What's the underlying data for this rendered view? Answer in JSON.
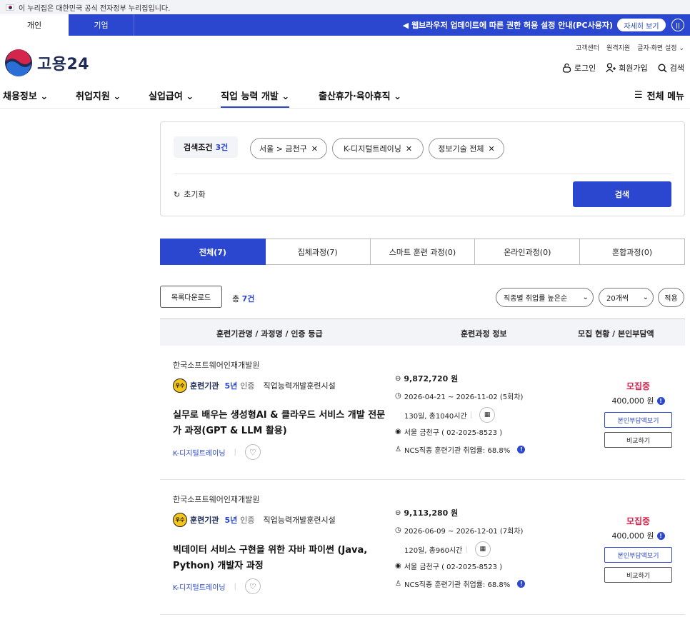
{
  "gov_banner": {
    "text": "이 누리집은 대한민국 공식 전자정부 누리집입니다."
  },
  "topbar": {
    "tabs": [
      "개인",
      "기업"
    ],
    "notice": "웹브라우저 업데이트에 따른 권한 허용 설정 안내(PC사용자)",
    "detail": "자세히 보기"
  },
  "header": {
    "logo": "고용24",
    "util": [
      "고객센터",
      "원격지원",
      "글자·화면 설정"
    ],
    "login": "로그인",
    "signup": "회원가입",
    "search": "검색"
  },
  "gnb": {
    "items": [
      "채용정보",
      "취업지원",
      "실업급여",
      "직업 능력 개발",
      "출산휴가·육아휴직"
    ],
    "allmenu": "전체 메뉴"
  },
  "search": {
    "cond_label": "검색조건",
    "cond_count": "3건",
    "chips": [
      "서울 > 금천구",
      "K-디지털트레이닝",
      "정보기술 전체"
    ],
    "reset": "초기화",
    "button": "검색"
  },
  "tabs": [
    "전체(7)",
    "집체과정(7)",
    "스마트 훈련 과정(0)",
    "온라인과정(0)",
    "혼합과정(0)"
  ],
  "controls": {
    "download": "목록다운로드",
    "total_prefix": "총",
    "total_count": "7건",
    "sort": "직종별 취업률 높은순",
    "per_page": "20개씩",
    "apply": "적용"
  },
  "table_header": [
    "훈련기관명 / 과정명 / 인증 등급",
    "훈련과정 정보",
    "모집 현황 / 본인부담액"
  ],
  "courses": [
    {
      "institution": "한국소프트웨어인재개발원",
      "cert_badge": "우수",
      "cert_name": "훈련기관",
      "cert_years": "5년",
      "cert_level": "인증",
      "cert_type": "직업능력개발훈련시설",
      "title": "실무로 배우는 생성형AI & 클라우드 서비스 개발 전문가 과정(GPT & LLM 활용)",
      "program": "K-디지털트레이닝",
      "price": "9,872,720 원",
      "period": "2026-04-21 ~ 2026-11-02 (5회차)",
      "hours": "130일, 총1040시간",
      "location": "서울 금천구 ( 02-2025-8523 )",
      "employment": "NCS직종 훈련기관 취업률: 68.8%",
      "status": "모집중",
      "fee": "400,000 원",
      "btn_fee": "본인부담액보기",
      "btn_compare": "비교하기"
    },
    {
      "institution": "한국소프트웨어인재개발원",
      "cert_badge": "우수",
      "cert_name": "훈련기관",
      "cert_years": "5년",
      "cert_level": "인증",
      "cert_type": "직업능력개발훈련시설",
      "title": "빅데이터 서비스 구현을 위한 자바 파이썬 (Java, Python) 개발자 과정",
      "program": "K-디지털트레이닝",
      "price": "9,113,280 원",
      "period": "2026-06-09 ~ 2026-12-01 (7회차)",
      "hours": "120일, 총960시간",
      "location": "서울 금천구 ( 02-2025-8523 )",
      "employment": "NCS직종 훈련기관 취업률: 68.8%",
      "status": "모집중",
      "fee": "400,000 원",
      "btn_fee": "본인부담액보기",
      "btn_compare": "비교하기"
    }
  ]
}
